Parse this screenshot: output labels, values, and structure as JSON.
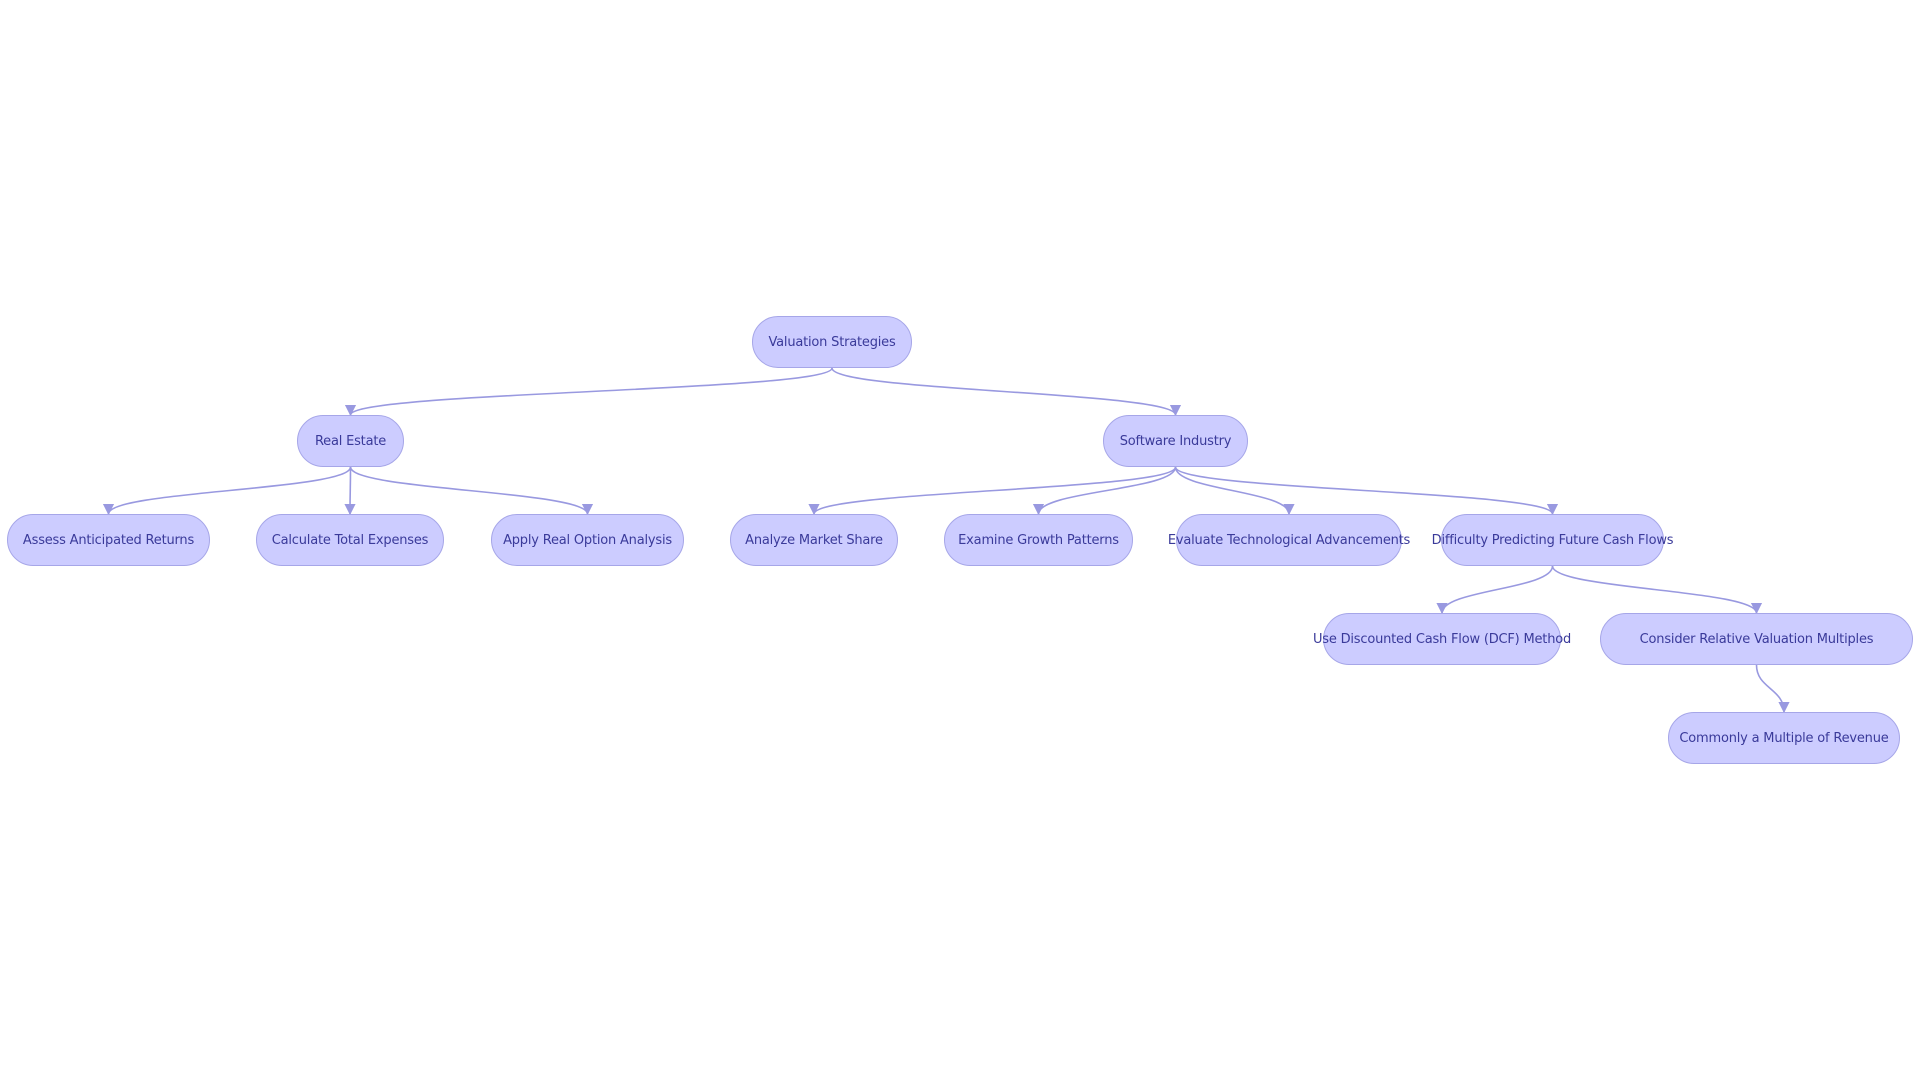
{
  "colors": {
    "node_fill": "#ccccff",
    "node_border": "#a6a6e8",
    "edge": "#9999e0",
    "text": "#3a3a9a"
  },
  "nodes": [
    {
      "id": "root",
      "label": "Valuation Strategies"
    },
    {
      "id": "real_estate",
      "label": "Real Estate"
    },
    {
      "id": "software",
      "label": "Software Industry"
    },
    {
      "id": "assess",
      "label": "Assess Anticipated Returns"
    },
    {
      "id": "calculate",
      "label": "Calculate Total Expenses"
    },
    {
      "id": "apply",
      "label": "Apply Real Option Analysis"
    },
    {
      "id": "analyze",
      "label": "Analyze Market Share"
    },
    {
      "id": "examine",
      "label": "Examine Growth Patterns"
    },
    {
      "id": "evaluate",
      "label": "Evaluate Technological Advancements"
    },
    {
      "id": "difficulty",
      "label": "Difficulty Predicting Future Cash Flows"
    },
    {
      "id": "dcf",
      "label": "Use Discounted Cash Flow (DCF) Method"
    },
    {
      "id": "consider",
      "label": "Consider Relative Valuation Multiples"
    },
    {
      "id": "commonly",
      "label": "Commonly a Multiple of Revenue"
    }
  ],
  "edges": [
    {
      "from": "root",
      "to": "real_estate"
    },
    {
      "from": "root",
      "to": "software"
    },
    {
      "from": "real_estate",
      "to": "assess"
    },
    {
      "from": "real_estate",
      "to": "calculate"
    },
    {
      "from": "real_estate",
      "to": "apply"
    },
    {
      "from": "software",
      "to": "analyze"
    },
    {
      "from": "software",
      "to": "examine"
    },
    {
      "from": "software",
      "to": "evaluate"
    },
    {
      "from": "software",
      "to": "difficulty"
    },
    {
      "from": "difficulty",
      "to": "dcf"
    },
    {
      "from": "difficulty",
      "to": "consider"
    },
    {
      "from": "consider",
      "to": "commonly"
    }
  ]
}
